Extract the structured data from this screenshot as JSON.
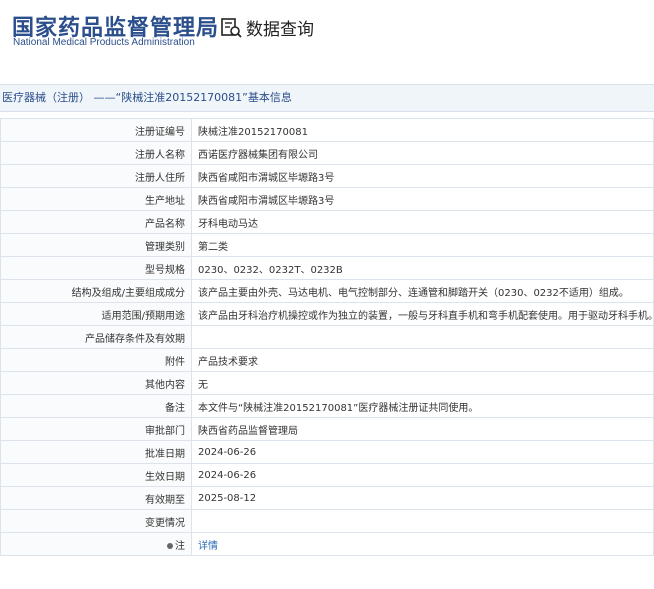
{
  "header": {
    "logo_cn": "国家药品监督管理局",
    "logo_en": "National Medical Products Administration",
    "query_label": "数据查询",
    "brand_color": "#2b4e8c"
  },
  "titlebar": {
    "text": "医疗器械（注册） ——“陕械注准20152170081”基本信息"
  },
  "rows": [
    {
      "label": "注册证编号",
      "value": "陕械注准20152170081"
    },
    {
      "label": "注册人名称",
      "value": "西诺医疗器械集团有限公司"
    },
    {
      "label": "注册人住所",
      "value": "陕西省咸阳市渭城区毕塬路3号"
    },
    {
      "label": "生产地址",
      "value": "陕西省咸阳市渭城区毕塬路3号"
    },
    {
      "label": "产品名称",
      "value": "牙科电动马达"
    },
    {
      "label": "管理类别",
      "value": "第二类"
    },
    {
      "label": "型号规格",
      "value": "0230、0232、0232T、0232B"
    },
    {
      "label": "结构及组成/主要组成成分",
      "value": "该产品主要由外壳、马达电机、电气控制部分、连通管和脚踏开关（0230、0232不适用）组成。"
    },
    {
      "label": "适用范围/预期用途",
      "value": "该产品由牙科治疗机操控或作为独立的装置，一般与牙科直手机和弯手机配套使用。用于驱动牙科手机。"
    },
    {
      "label": "产品储存条件及有效期",
      "value": ""
    },
    {
      "label": "附件",
      "value": "产品技术要求"
    },
    {
      "label": "其他内容",
      "value": "无"
    },
    {
      "label": "备注",
      "value": "本文件与“陕械注准20152170081”医疗器械注册证共同使用。"
    },
    {
      "label": "审批部门",
      "value": "陕西省药品监督管理局"
    },
    {
      "label": "批准日期",
      "value": "2024-06-26"
    },
    {
      "label": "生效日期",
      "value": "2024-06-26"
    },
    {
      "label": "有效期至",
      "value": "2025-08-12"
    },
    {
      "label": "变更情况",
      "value": ""
    }
  ],
  "note_row": {
    "label": "注",
    "link": "详情",
    "pin_icon": "pin-icon"
  }
}
